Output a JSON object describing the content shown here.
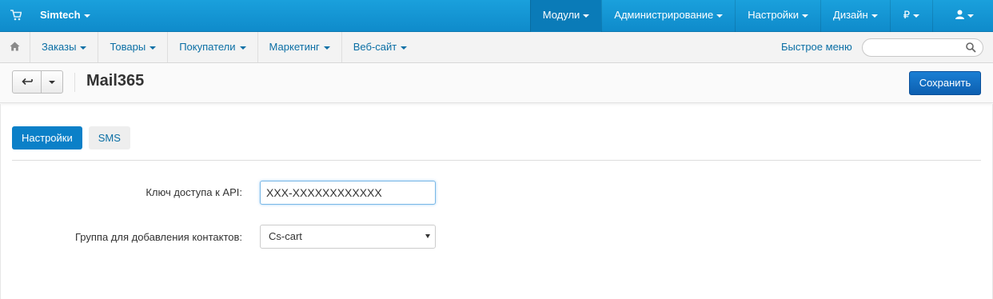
{
  "topbar": {
    "brand": "Simtech",
    "nav": [
      {
        "label": "Модули",
        "active": true
      },
      {
        "label": "Администрирование",
        "active": false
      },
      {
        "label": "Настройки",
        "active": false
      },
      {
        "label": "Дизайн",
        "active": false
      }
    ],
    "currency": "₽",
    "user_icon": "user-icon",
    "cart_icon": "cart-icon"
  },
  "navbar": {
    "home_icon": "home-icon",
    "items": [
      {
        "label": "Заказы"
      },
      {
        "label": "Товары"
      },
      {
        "label": "Покупатели"
      },
      {
        "label": "Маркетинг"
      },
      {
        "label": "Веб-сайт"
      }
    ],
    "quick_menu": "Быстрое меню",
    "search_placeholder": "",
    "search_icon": "search-icon"
  },
  "actionbar": {
    "page_title": "Mail365",
    "save_label": "Сохранить",
    "back_icon": "back-arrow-icon"
  },
  "tabs": [
    {
      "label": "Настройки",
      "active": true
    },
    {
      "label": "SMS",
      "active": false
    }
  ],
  "form": {
    "api_key_label": "Ключ доступа к API:",
    "api_key_value": "XXX-XXXXXXXXXXXX",
    "group_label": "Группа для добавления контактов:",
    "group_value": "Cs-cart"
  },
  "colors": {
    "topbar": "#1aa0dc",
    "topbar_active": "#0a7bb8",
    "link": "#0b6fa5",
    "primary_button": "#0d5fb0",
    "tab_active": "#0b80c8"
  }
}
